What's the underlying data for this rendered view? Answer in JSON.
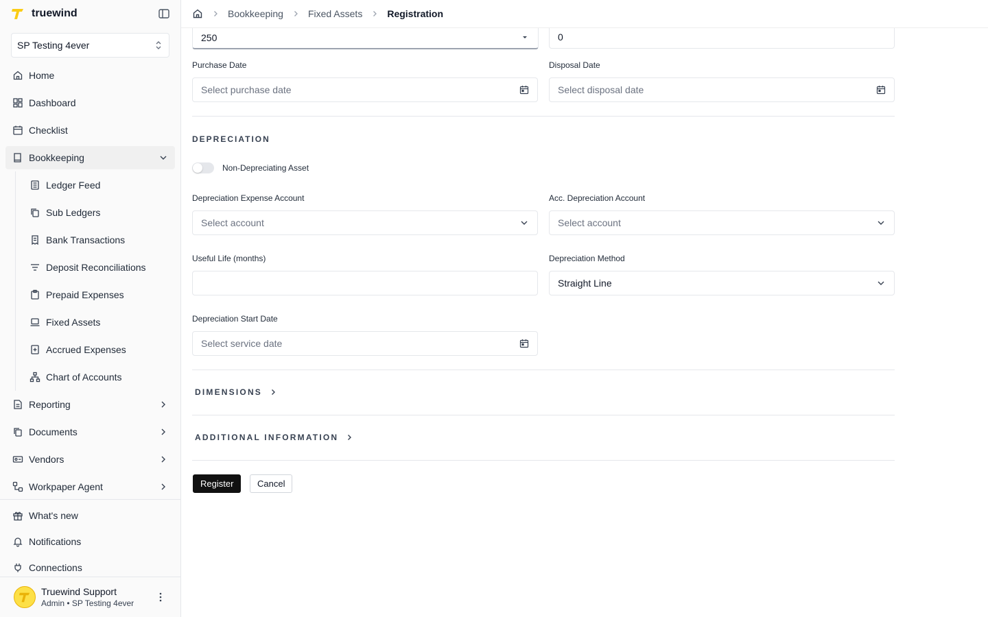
{
  "brand": {
    "name": "truewind"
  },
  "org": {
    "name": "SP Testing 4ever"
  },
  "nav": {
    "home": "Home",
    "dashboard": "Dashboard",
    "checklist": "Checklist",
    "bookkeeping": "Bookkeeping",
    "sub_items": [
      {
        "label": "Ledger Feed"
      },
      {
        "label": "Sub Ledgers"
      },
      {
        "label": "Bank Transactions"
      },
      {
        "label": "Deposit Reconciliations"
      },
      {
        "label": "Prepaid Expenses"
      },
      {
        "label": "Fixed Assets"
      },
      {
        "label": "Accrued Expenses"
      },
      {
        "label": "Chart of Accounts"
      }
    ],
    "reporting": "Reporting",
    "documents": "Documents",
    "vendors": "Vendors",
    "workpaper": "Workpaper Agent"
  },
  "bottom_nav": {
    "whats_new": "What's new",
    "notifications": "Notifications",
    "connections": "Connections"
  },
  "user": {
    "name": "Truewind Support",
    "role": "Admin • SP Testing 4ever"
  },
  "breadcrumb": {
    "level1": "Bookkeeping",
    "level2": "Fixed Assets",
    "current": "Registration"
  },
  "form": {
    "top_left_value": "250",
    "top_right_value": "0",
    "purchase_date_label": "Purchase Date",
    "purchase_date_placeholder": "Select purchase date",
    "disposal_date_label": "Disposal Date",
    "disposal_date_placeholder": "Select disposal date",
    "depreciation_title": "DEPRECIATION",
    "non_depreciating_label": "Non-Depreciating Asset",
    "dep_expense_label": "Depreciation Expense Account",
    "dep_expense_placeholder": "Select account",
    "acc_dep_label": "Acc. Depreciation Account",
    "acc_dep_placeholder": "Select account",
    "useful_life_label": "Useful Life (months)",
    "useful_life_value": "",
    "dep_method_label": "Depreciation Method",
    "dep_method_value": "Straight Line",
    "dep_start_label": "Depreciation Start Date",
    "dep_start_placeholder": "Select service date",
    "dimensions_title": "DIMENSIONS",
    "additional_title": "ADDITIONAL INFORMATION",
    "register_label": "Register",
    "cancel_label": "Cancel"
  }
}
